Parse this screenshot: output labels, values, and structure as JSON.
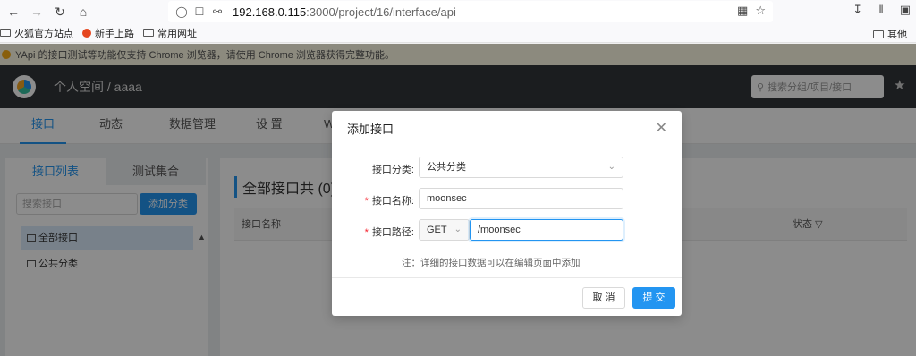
{
  "browser": {
    "url_host": "192.168.0.115",
    "url_path": ":3000/project/16/interface/api",
    "bookmarks": [
      "火狐官方站点",
      "新手上路",
      "常用网址"
    ],
    "bookmarks_other": "其他"
  },
  "app": {
    "notice": "YApi 的接口测试等功能仅支持 Chrome 浏览器，请使用 Chrome 浏览器获得完整功能。",
    "breadcrumb": "个人空间 / aaaa",
    "search_placeholder": "搜索分组/项目/接口",
    "tabs": [
      "接口",
      "动态",
      "数据管理",
      "设 置",
      "W"
    ],
    "sidebar": {
      "tabs": [
        "接口列表",
        "测试集合"
      ],
      "search_placeholder": "搜索接口",
      "add_button": "添加分类",
      "items": [
        "全部接口",
        "公共分类"
      ]
    },
    "main": {
      "title": "全部接口共 (0) 个",
      "columns": [
        "接口名称",
        "状态"
      ]
    }
  },
  "modal": {
    "title": "添加接口",
    "category_label": "接口分类:",
    "category_value": "公共分类",
    "name_label": "接口名称:",
    "name_value": "moonsec",
    "path_label": "接口路径:",
    "method_value": "GET",
    "path_value": "/moonsec",
    "note": "注：详细的接口数据可以在编辑页面中添加",
    "cancel": "取 消",
    "submit": "提 交"
  },
  "colors": {
    "accent": "#2395f1",
    "header": "#32363a",
    "required": "#f5222d"
  }
}
